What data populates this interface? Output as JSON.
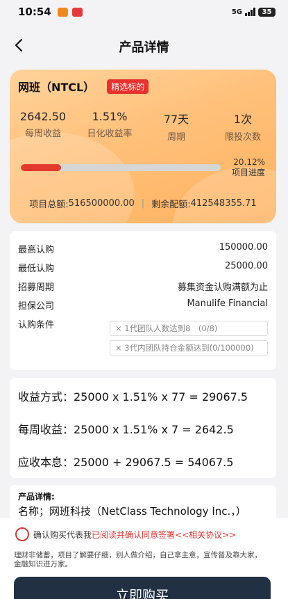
{
  "status_bar": {
    "time": "10:54",
    "network": "5G",
    "battery": "35"
  },
  "nav": {
    "title": "产品详情",
    "back_icon": "chevron-left-icon"
  },
  "product": {
    "name": "网班（NTCL）",
    "tag": "精选标的",
    "stats": [
      {
        "value": "2642.50",
        "label": "每周收益"
      },
      {
        "value": "1.51%",
        "label": "日化收益率"
      },
      {
        "value": "77天",
        "label": "周期"
      },
      {
        "value": "1次",
        "label": "限投次数"
      }
    ],
    "progress_percent": 20.12,
    "progress_text": "20.12%",
    "progress_label": "项目进度",
    "total_label": "项目总额:",
    "total_value": "516500000.00",
    "remaining_label": "剩余配额:",
    "remaining_value": "412548355.71",
    "colors": {
      "accent": "#e43a2e",
      "card": "#ffc07a"
    }
  },
  "info": {
    "rows": [
      {
        "label": "最高认购",
        "value": "150000.00"
      },
      {
        "label": "最低认购",
        "value": "25000.00"
      },
      {
        "label": "招募周期",
        "value": "募集资金认购满额为止"
      },
      {
        "label": "担保公司",
        "value": "Manulife Financial"
      }
    ],
    "conditions_label": "认购条件",
    "conditions": [
      "× 1代团队人数达到8　(0/8)",
      "× 3代内团队持仓金额达到(0/100000)"
    ]
  },
  "calculation": {
    "lines": [
      "收益方式：25000 x 1.51% x 77 = 29067.5",
      "每周收益：25000 x 1.51% x 7 = 2642.5",
      "应收本息：25000 + 29067.5 = 54067.5"
    ]
  },
  "detail": {
    "title": "产品详情:",
    "text": "名称；网班科技（NetClass Technology Inc.，）"
  },
  "agreement": {
    "prefix": "确认购买代表我",
    "link": "已阅读并确认同意签署<<相关协议>>",
    "disclaimer": "理财非储蓄，项目了解要仔细，别人做介绍，自己拿主意，宣传普及靠大家，金融知识进万家。"
  },
  "buy_button": {
    "label": "立即购买"
  }
}
